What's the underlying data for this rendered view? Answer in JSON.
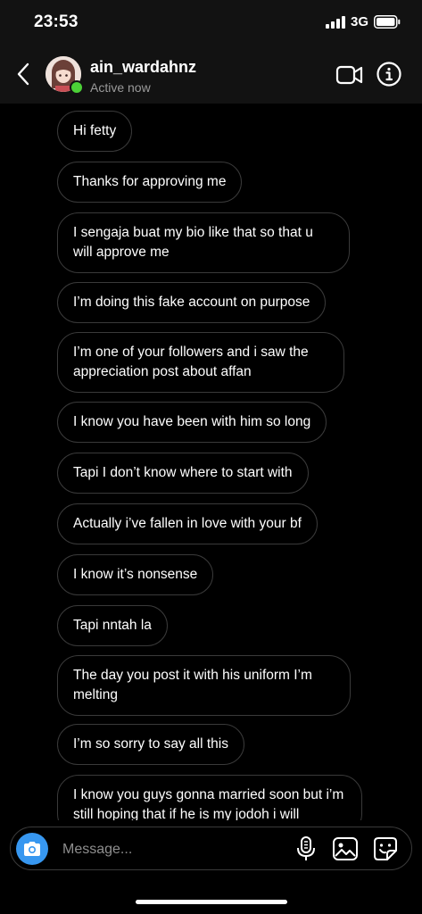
{
  "status_bar": {
    "time": "23:53",
    "network": "3G",
    "icons": [
      "signal-icon",
      "battery-icon"
    ]
  },
  "header": {
    "username": "ain_wardahnz",
    "status": "Active now",
    "icons": [
      "back-arrow-icon",
      "video-call-icon",
      "info-icon"
    ],
    "online_color": "#4cd137"
  },
  "messages": [
    "Hi fetty",
    "Thanks for approving me",
    "I sengaja buat my bio like that so that u will approve me",
    "I’m doing this fake account on purpose",
    "I’m one of your followers and i saw the appreciation post about affan",
    "I know you have been with him so long",
    "Tapi I don’t know where to start with",
    "Actually i’ve fallen in love with your bf",
    "I know it’s nonsense",
    "Tapi nntah la",
    "The day you post it with his uniform I’m melting",
    "I’m so sorry to say all this",
    "I know you guys gonna married soon but i’m still hoping that if he is my jodoh i will"
  ],
  "composer": {
    "placeholder": "Message...",
    "icons": [
      "camera-icon",
      "microphone-icon",
      "gallery-icon",
      "sticker-icon"
    ],
    "camera_color": "#3797f0"
  },
  "colors": {
    "background": "#000000",
    "header_background": "#121212",
    "bubble_border": "#3a3a3a",
    "secondary_text": "#9a9a9a"
  }
}
